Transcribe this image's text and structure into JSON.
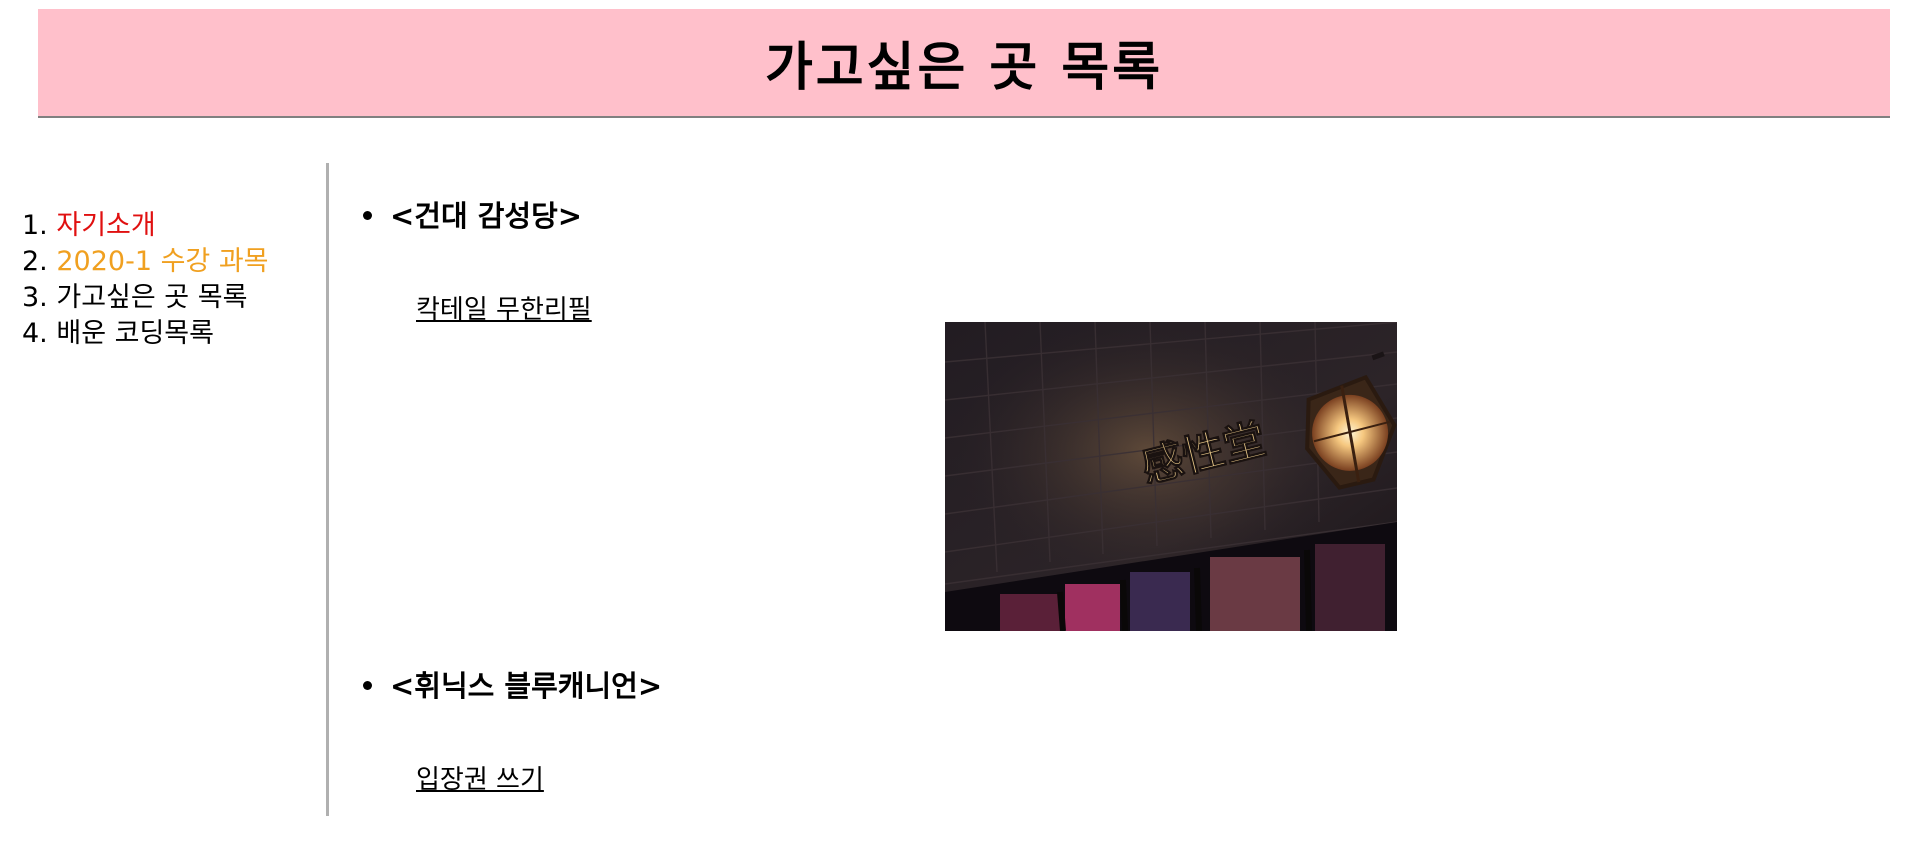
{
  "header": {
    "title": "가고싶은 곳 목록"
  },
  "nav": {
    "items": [
      {
        "number": "1.",
        "label": "자기소개",
        "color": "#e01010"
      },
      {
        "number": "2.",
        "label": "2020-1 수강 과목",
        "color": "#f0a020"
      },
      {
        "number": "3.",
        "label": "가고싶은 곳 목록",
        "color": "#000000"
      },
      {
        "number": "4.",
        "label": "배운 코딩목록",
        "color": "#000000"
      }
    ]
  },
  "places": [
    {
      "title": "<건대 감성당>",
      "link": "칵테일 무한리필",
      "image_sign": "感性堂"
    },
    {
      "title": "<휘닉스 블루캐니언>",
      "link": "입장권 쓰기"
    }
  ],
  "colors": {
    "header_bg": "#ffc0cb",
    "divider": "#b0b0b0"
  }
}
